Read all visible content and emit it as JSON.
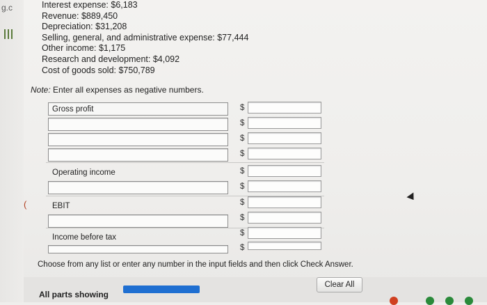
{
  "sidebar": {
    "tab_text": "g.c"
  },
  "given": {
    "lines": [
      "Interest expense:  $6,183",
      "Revenue:  $889,450",
      "Depreciation:  $31,208",
      "Selling, general, and administrative expense:  $77,444",
      "Other income:  $1,175",
      "Research and development:  $4,092",
      "Cost of goods sold:  $750,789"
    ]
  },
  "note": {
    "label": "Note:",
    "text": " Enter all expenses as negative numbers."
  },
  "statement": {
    "currency": "$",
    "rows": [
      {
        "label": "Gross profit",
        "value": ""
      },
      {
        "label": "",
        "value": ""
      },
      {
        "label": "",
        "value": ""
      },
      {
        "label": "",
        "value": ""
      },
      {
        "label": "Operating income",
        "value": ""
      },
      {
        "label": "",
        "value": ""
      },
      {
        "label": "EBIT",
        "value": ""
      },
      {
        "label": "",
        "value": ""
      },
      {
        "label": "Income before tax",
        "value": ""
      },
      {
        "label": "",
        "value": ""
      }
    ]
  },
  "instructions": "Choose from any list or enter any number in the input fields and then click Check Answer.",
  "footer": {
    "parts_label": "All parts showing",
    "progress_fraction": 1.0,
    "clear_all_label": "Clear All"
  },
  "colors": {
    "accent": "#1f6fd1",
    "dot_colors": [
      "#d04020",
      "#2a8a3a",
      "#2a8a3a",
      "#2a8a3a"
    ]
  }
}
